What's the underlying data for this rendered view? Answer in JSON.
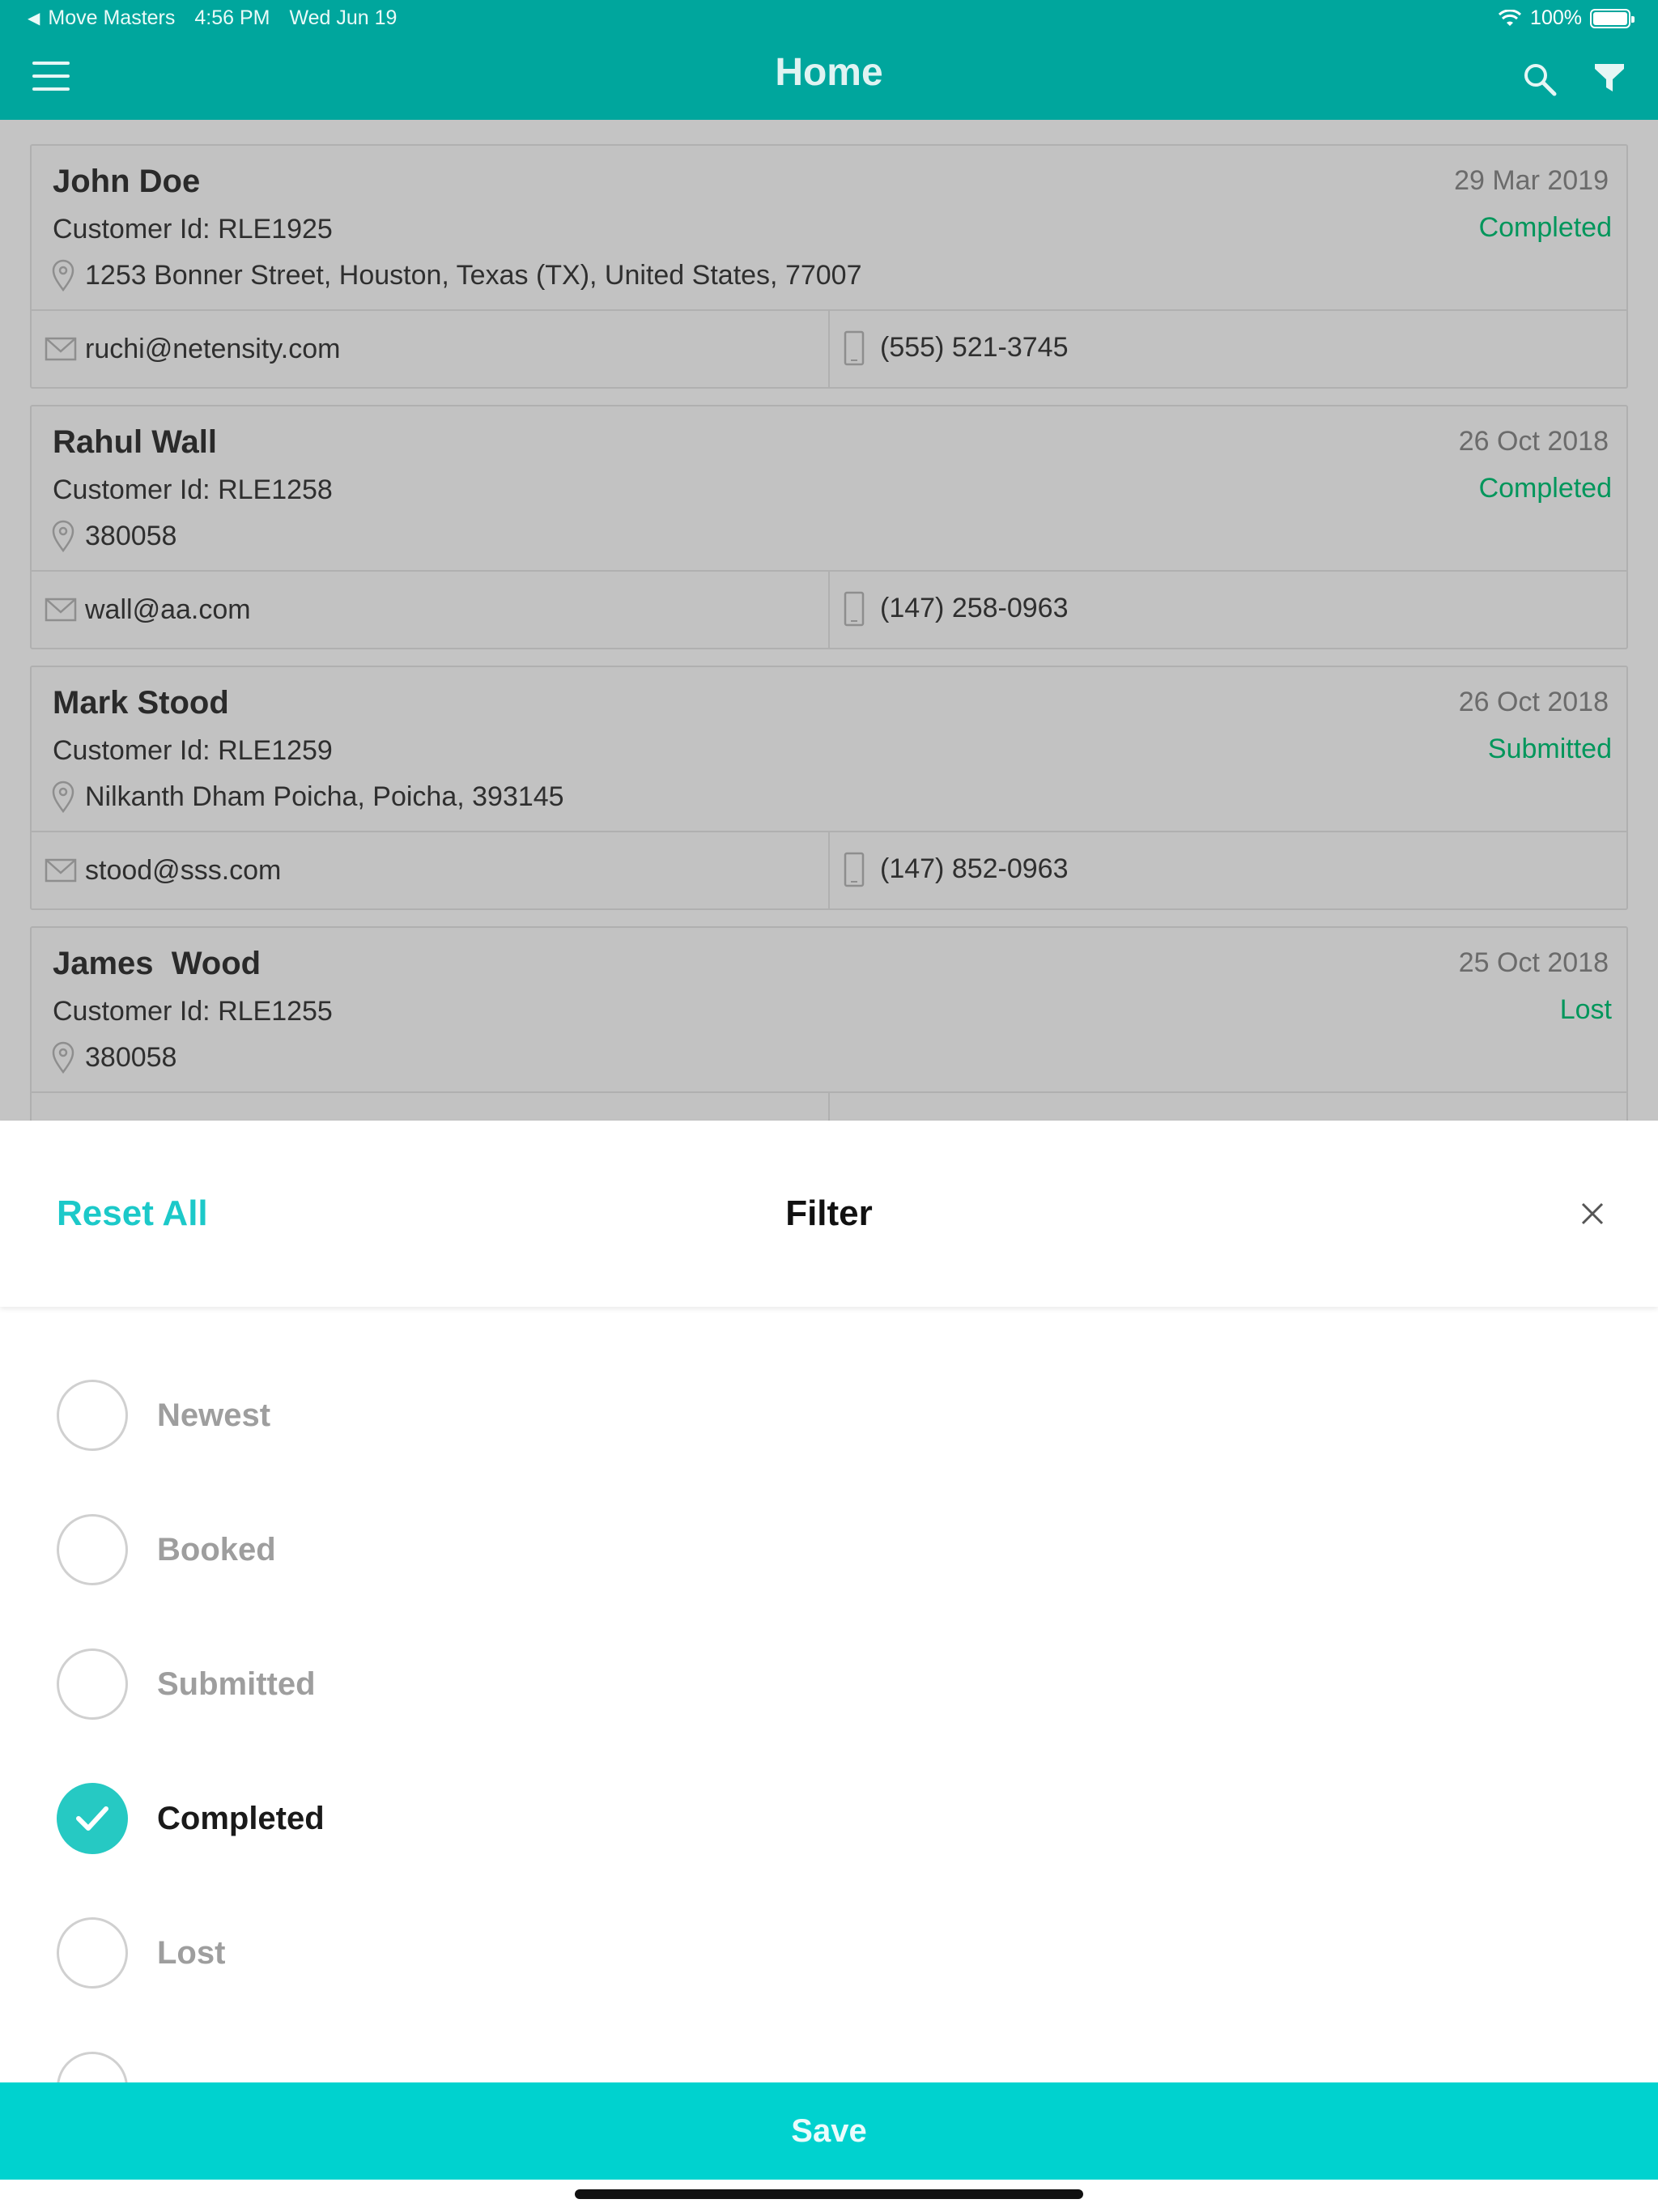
{
  "status_bar": {
    "back_app": "Move Masters",
    "time": "4:56 PM",
    "date": "Wed Jun 19",
    "battery": "100%"
  },
  "header": {
    "title": "Home"
  },
  "customers": [
    {
      "name": "John Doe",
      "customer_id": "Customer Id: RLE1925",
      "address": "1253 Bonner Street, Houston, Texas (TX), United States, 77007",
      "date": "29 Mar 2019",
      "status": "Completed",
      "email": "ruchi@netensity.com",
      "phone": "(555) 521-3745"
    },
    {
      "name": "Rahul Wall",
      "customer_id": "Customer Id: RLE1258",
      "address": "380058",
      "date": "26 Oct 2018",
      "status": "Completed",
      "email": "wall@aa.com",
      "phone": "(147) 258-0963"
    },
    {
      "name": "Mark Stood",
      "customer_id": "Customer Id: RLE1259",
      "address": "Nilkanth Dham Poicha, Poicha, 393145",
      "date": "26 Oct 2018",
      "status": "Submitted",
      "email": "stood@sss.com",
      "phone": "(147) 852-0963"
    },
    {
      "name": "James  Wood",
      "customer_id": "Customer Id: RLE1255",
      "address": "380058",
      "date": "25 Oct 2018",
      "status": "Lost",
      "email": "",
      "phone": ""
    }
  ],
  "filter": {
    "reset_label": "Reset All",
    "title": "Filter",
    "options": [
      {
        "label": "Newest",
        "checked": false
      },
      {
        "label": "Booked",
        "checked": false
      },
      {
        "label": "Submitted",
        "checked": false
      },
      {
        "label": "Completed",
        "checked": true
      },
      {
        "label": "Lost",
        "checked": false
      }
    ],
    "save_label": "Save"
  },
  "colors": {
    "accent": "#00a69d",
    "status_green": "#00965b",
    "teal_action": "#1cc9c9",
    "save_bar": "#00d2cf"
  }
}
